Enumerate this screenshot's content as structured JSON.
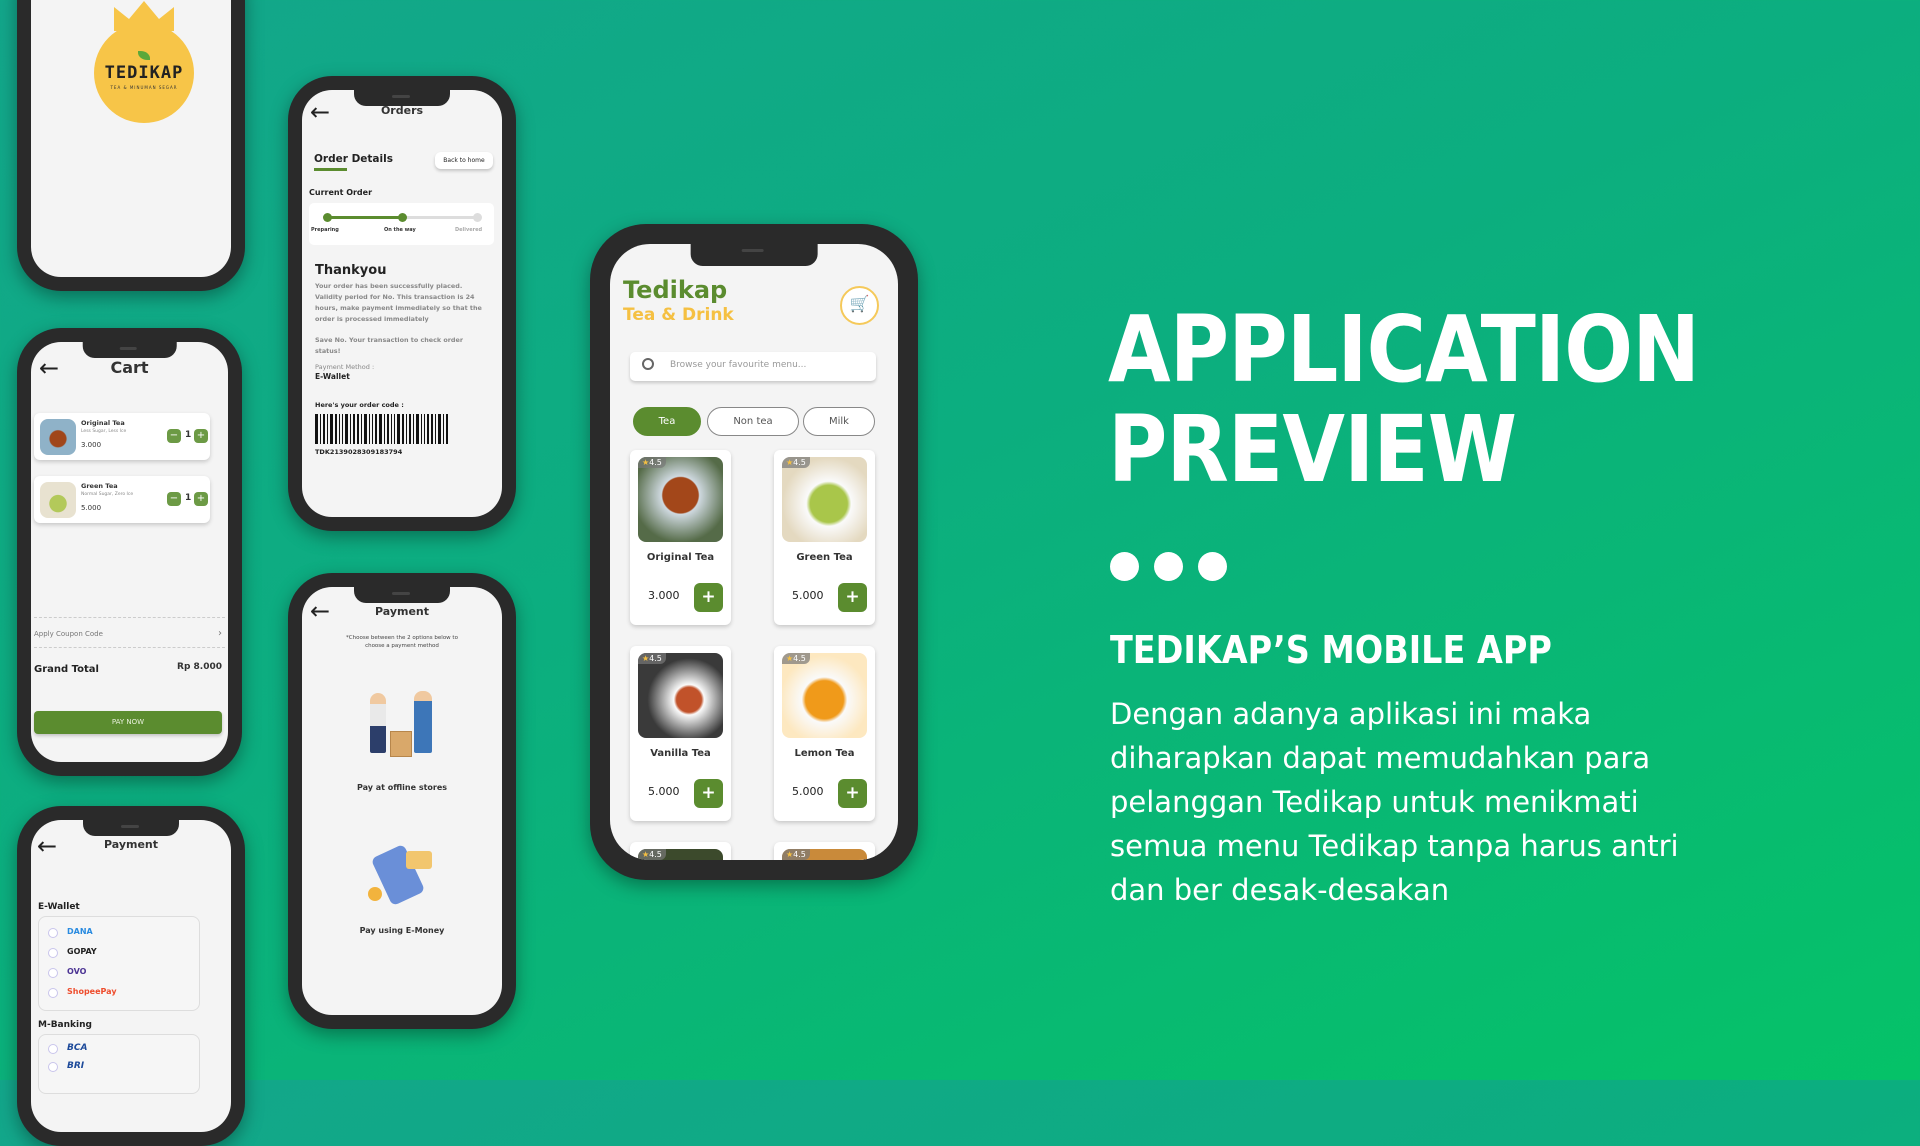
{
  "splash": {
    "logo_text": "TEDIKAP",
    "logo_tagline": "TEA & MINUMAN SEGAR"
  },
  "cart": {
    "title": "Cart",
    "items": [
      {
        "name": "Original Tea",
        "note": "Less Sugar, Less Ice",
        "price": "3.000",
        "qty": "1"
      },
      {
        "name": "Green Tea",
        "note": "Normal Sugar, Zero Ice",
        "price": "5.000",
        "qty": "1"
      }
    ],
    "coupon_label": "Apply Coupon Code",
    "grand_total_label": "Grand Total",
    "grand_total": "Rp 8.000",
    "pay_now": "PAY NOW"
  },
  "wallet_payment": {
    "title": "Payment",
    "ewallet_label": "E-Wallet",
    "ewallets": [
      "DANA",
      "GOPAY",
      "OVO",
      "ShopeePay"
    ],
    "mbanking_label": "M-Banking",
    "banks": [
      "BCA",
      "BRI"
    ]
  },
  "orders": {
    "title": "Orders",
    "section": "Order Details",
    "back_home": "Back to home",
    "current_order": "Current Order",
    "steps": [
      "Preparing",
      "On the way",
      "Delivered"
    ],
    "progress_step": 2,
    "thank_title": "Thankyou",
    "thank_text": "Your order has been successfully placed. Validity period for No. This transaction is 24 hours, make payment immediately so that the order is processed immediately",
    "save_text": "Save No. Your transaction to check order status!",
    "payment_method_label": "Payment Method :",
    "payment_method": "E-Wallet",
    "code_label": "Here's your order code :",
    "code": "TDK2139028309183794"
  },
  "payment_options": {
    "title": "Payment",
    "note": "*Choose between the 2 options below to choose a payment method",
    "option_offline": "Pay at offline stores",
    "option_emoney": "Pay using E-Money"
  },
  "home": {
    "brand": "Tedikap",
    "subbrand": "Tea & Drink",
    "search_placeholder": "Browse your favourite menu...",
    "tabs": [
      "Tea",
      "Non tea",
      "Milk"
    ],
    "active_tab": "Tea",
    "products": [
      {
        "name": "Original Tea",
        "price": "3.000",
        "rating": "4.5"
      },
      {
        "name": "Green Tea",
        "price": "5.000",
        "rating": "4.5"
      },
      {
        "name": "Vanilla Tea",
        "price": "5.000",
        "rating": "4.5"
      },
      {
        "name": "Lemon Tea",
        "price": "5.000",
        "rating": "4.5"
      },
      {
        "rating": "4.5"
      },
      {
        "rating": "4.5"
      }
    ],
    "add_label": "+"
  },
  "hero": {
    "title_line1": "APPLICATION",
    "title_line2": "PREVIEW",
    "subtitle": "TEDIKAP’S MOBILE APP",
    "description": "Dengan adanya aplikasi ini maka diharapkan dapat memudahkan para pelanggan Tedikap untuk menikmati semua menu Tedikap tanpa harus antri dan ber desak-desakan"
  },
  "colors": {
    "brand_green": "#5b8c2f",
    "brand_yellow": "#f5c042",
    "bg_top": "#13a68b",
    "bg_bottom": "#05c268"
  }
}
